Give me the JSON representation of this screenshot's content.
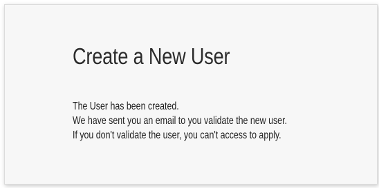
{
  "page": {
    "title": "Create a New User",
    "messages": [
      "The User has been created.",
      "We have sent you an email to you validate the new user.",
      "If you don't validate the user, you can't access to apply."
    ]
  }
}
